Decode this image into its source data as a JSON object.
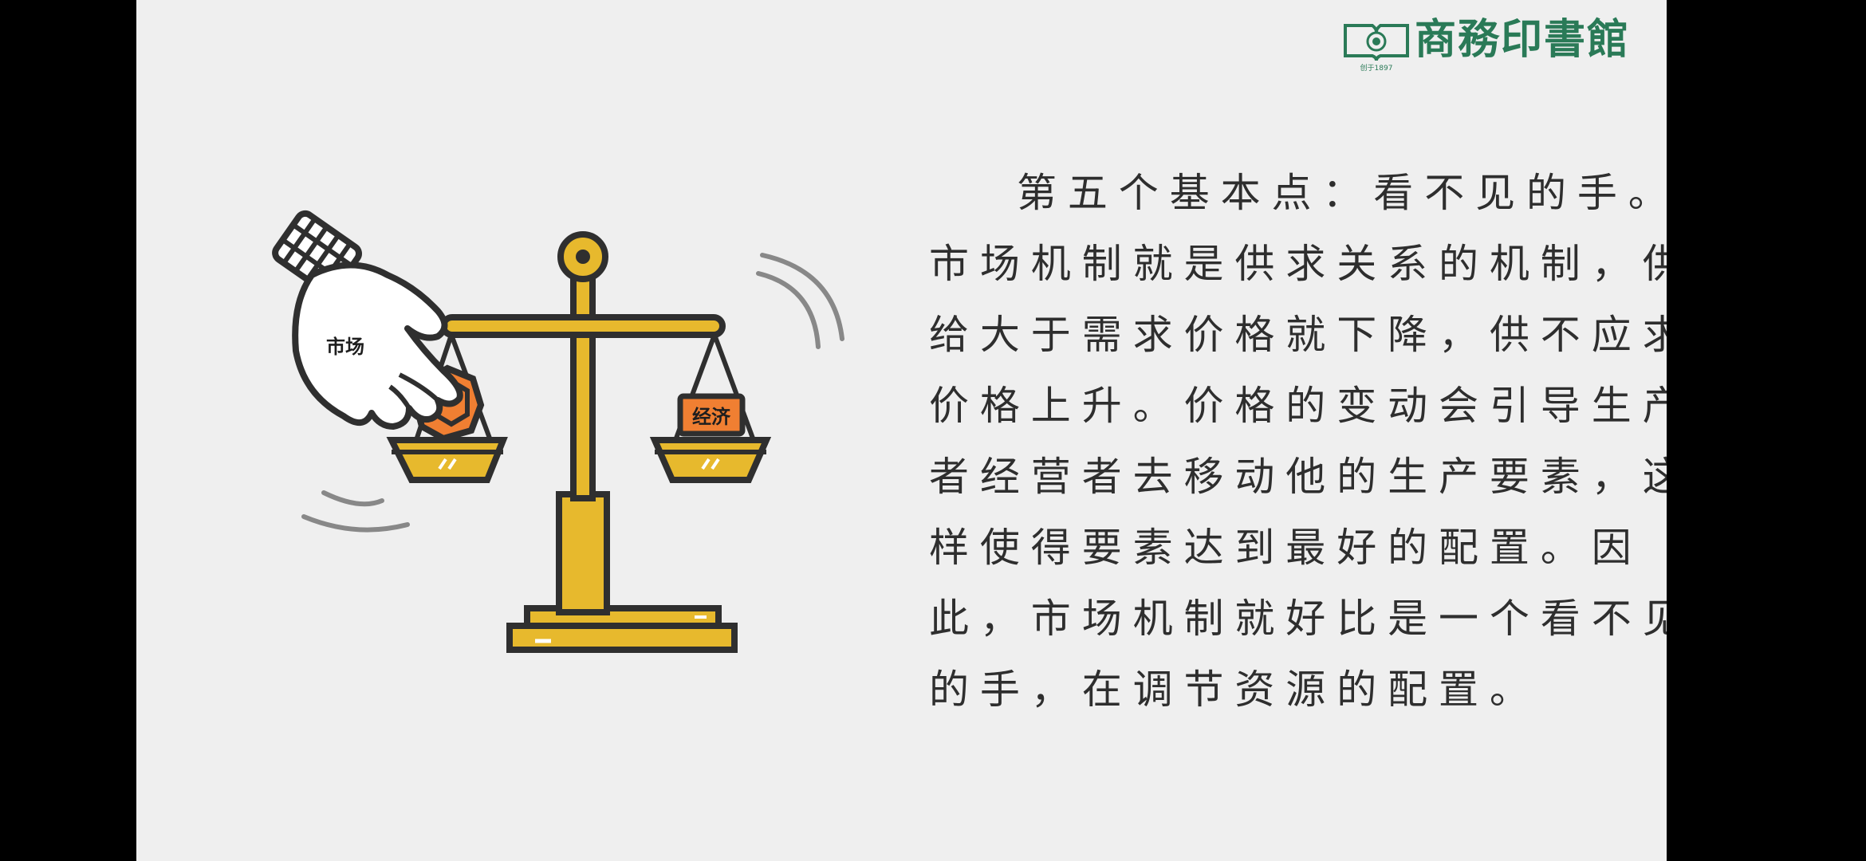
{
  "publisher": {
    "name": "商務印書館",
    "seal_text": "创于1897"
  },
  "illustration": {
    "hand_label": "市场",
    "weight_label": "经济",
    "colors": {
      "gold": "#e7b92d",
      "outline": "#2f2f2f",
      "orange": "#f07f32",
      "background": "#efefef"
    }
  },
  "paragraph": {
    "lines": [
      "第五个基本点：看不见的手。",
      "市场机制就是供求关系的机制，供",
      "给大于需求价格就下降，供不应求",
      "价格上升。价格的变动会引导生产",
      "者经营者去移动他的生产要素，这",
      "样使得要素达到最好的配置。因",
      "此，市场机制就好比是一个看不见",
      "的手，在调节资源的配置。"
    ]
  }
}
